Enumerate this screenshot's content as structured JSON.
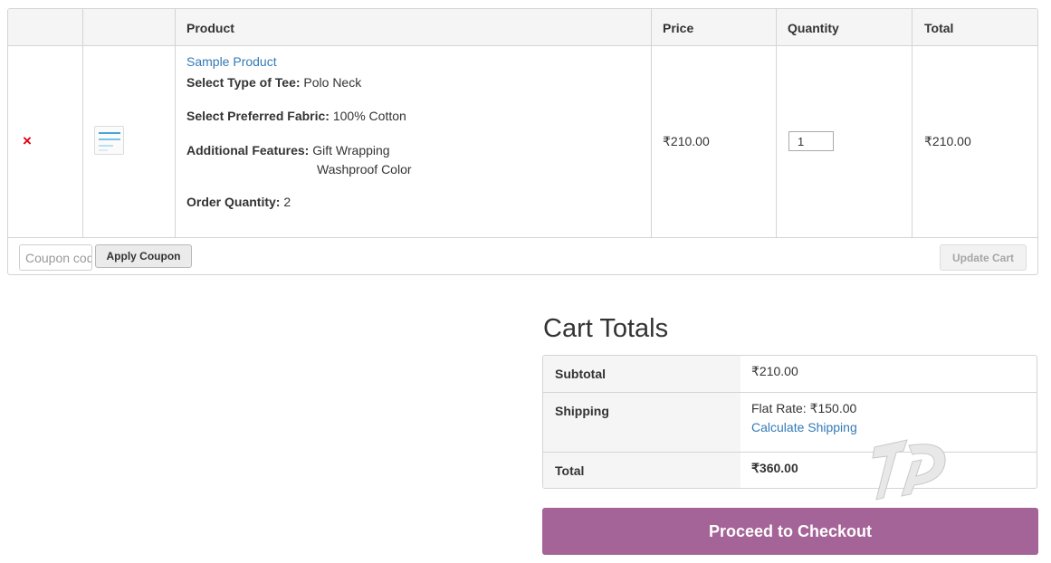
{
  "table": {
    "headers": {
      "product": "Product",
      "price": "Price",
      "quantity": "Quantity",
      "total": "Total"
    },
    "row": {
      "remove_symbol": "×",
      "product_name": "Sample Product",
      "meta": [
        {
          "label": "Select Type of Tee:",
          "value": "Polo Neck"
        },
        {
          "label": "Select Preferred Fabric:",
          "value": "100% Cotton"
        },
        {
          "label": "Additional Features:",
          "value": "Gift Wrapping",
          "value2": "Washproof Color"
        },
        {
          "label": "Order Quantity:",
          "value": "2"
        }
      ],
      "price": "₹210.00",
      "quantity": "1",
      "total": "₹210.00"
    },
    "actions": {
      "coupon_placeholder": "Coupon code",
      "apply_label": "Apply Coupon",
      "update_label": "Update Cart"
    }
  },
  "totals": {
    "title": "Cart Totals",
    "subtotal_label": "Subtotal",
    "subtotal_value": "₹210.00",
    "shipping_label": "Shipping",
    "shipping_value": "Flat Rate: ₹150.00",
    "shipping_link": "Calculate Shipping",
    "total_label": "Total",
    "total_value": "₹360.00",
    "checkout_label": "Proceed to Checkout"
  },
  "colors": {
    "checkout_bg": "#a46497",
    "link": "#337ab7",
    "remove": "#e2000f"
  }
}
